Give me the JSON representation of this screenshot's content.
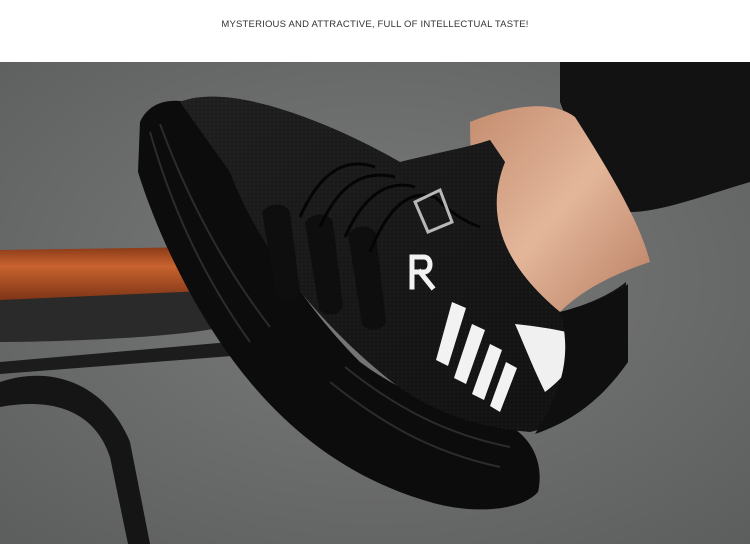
{
  "banner": {
    "text": "MYSTERIOUS AND ATTRACTIVE, FULL OF INTELLECTUAL TASTE!"
  },
  "photo": {
    "subject": "black knit lace-up sneaker on a foot resting on a stool",
    "colors": {
      "background": "#6e6f6f",
      "shoe": "#141414",
      "sole": "#0c0c0c",
      "stripes": "#f2f2f2",
      "stool_top": "#b5532a",
      "skin": "#d8ab8f",
      "sleeve": "#121212"
    }
  }
}
